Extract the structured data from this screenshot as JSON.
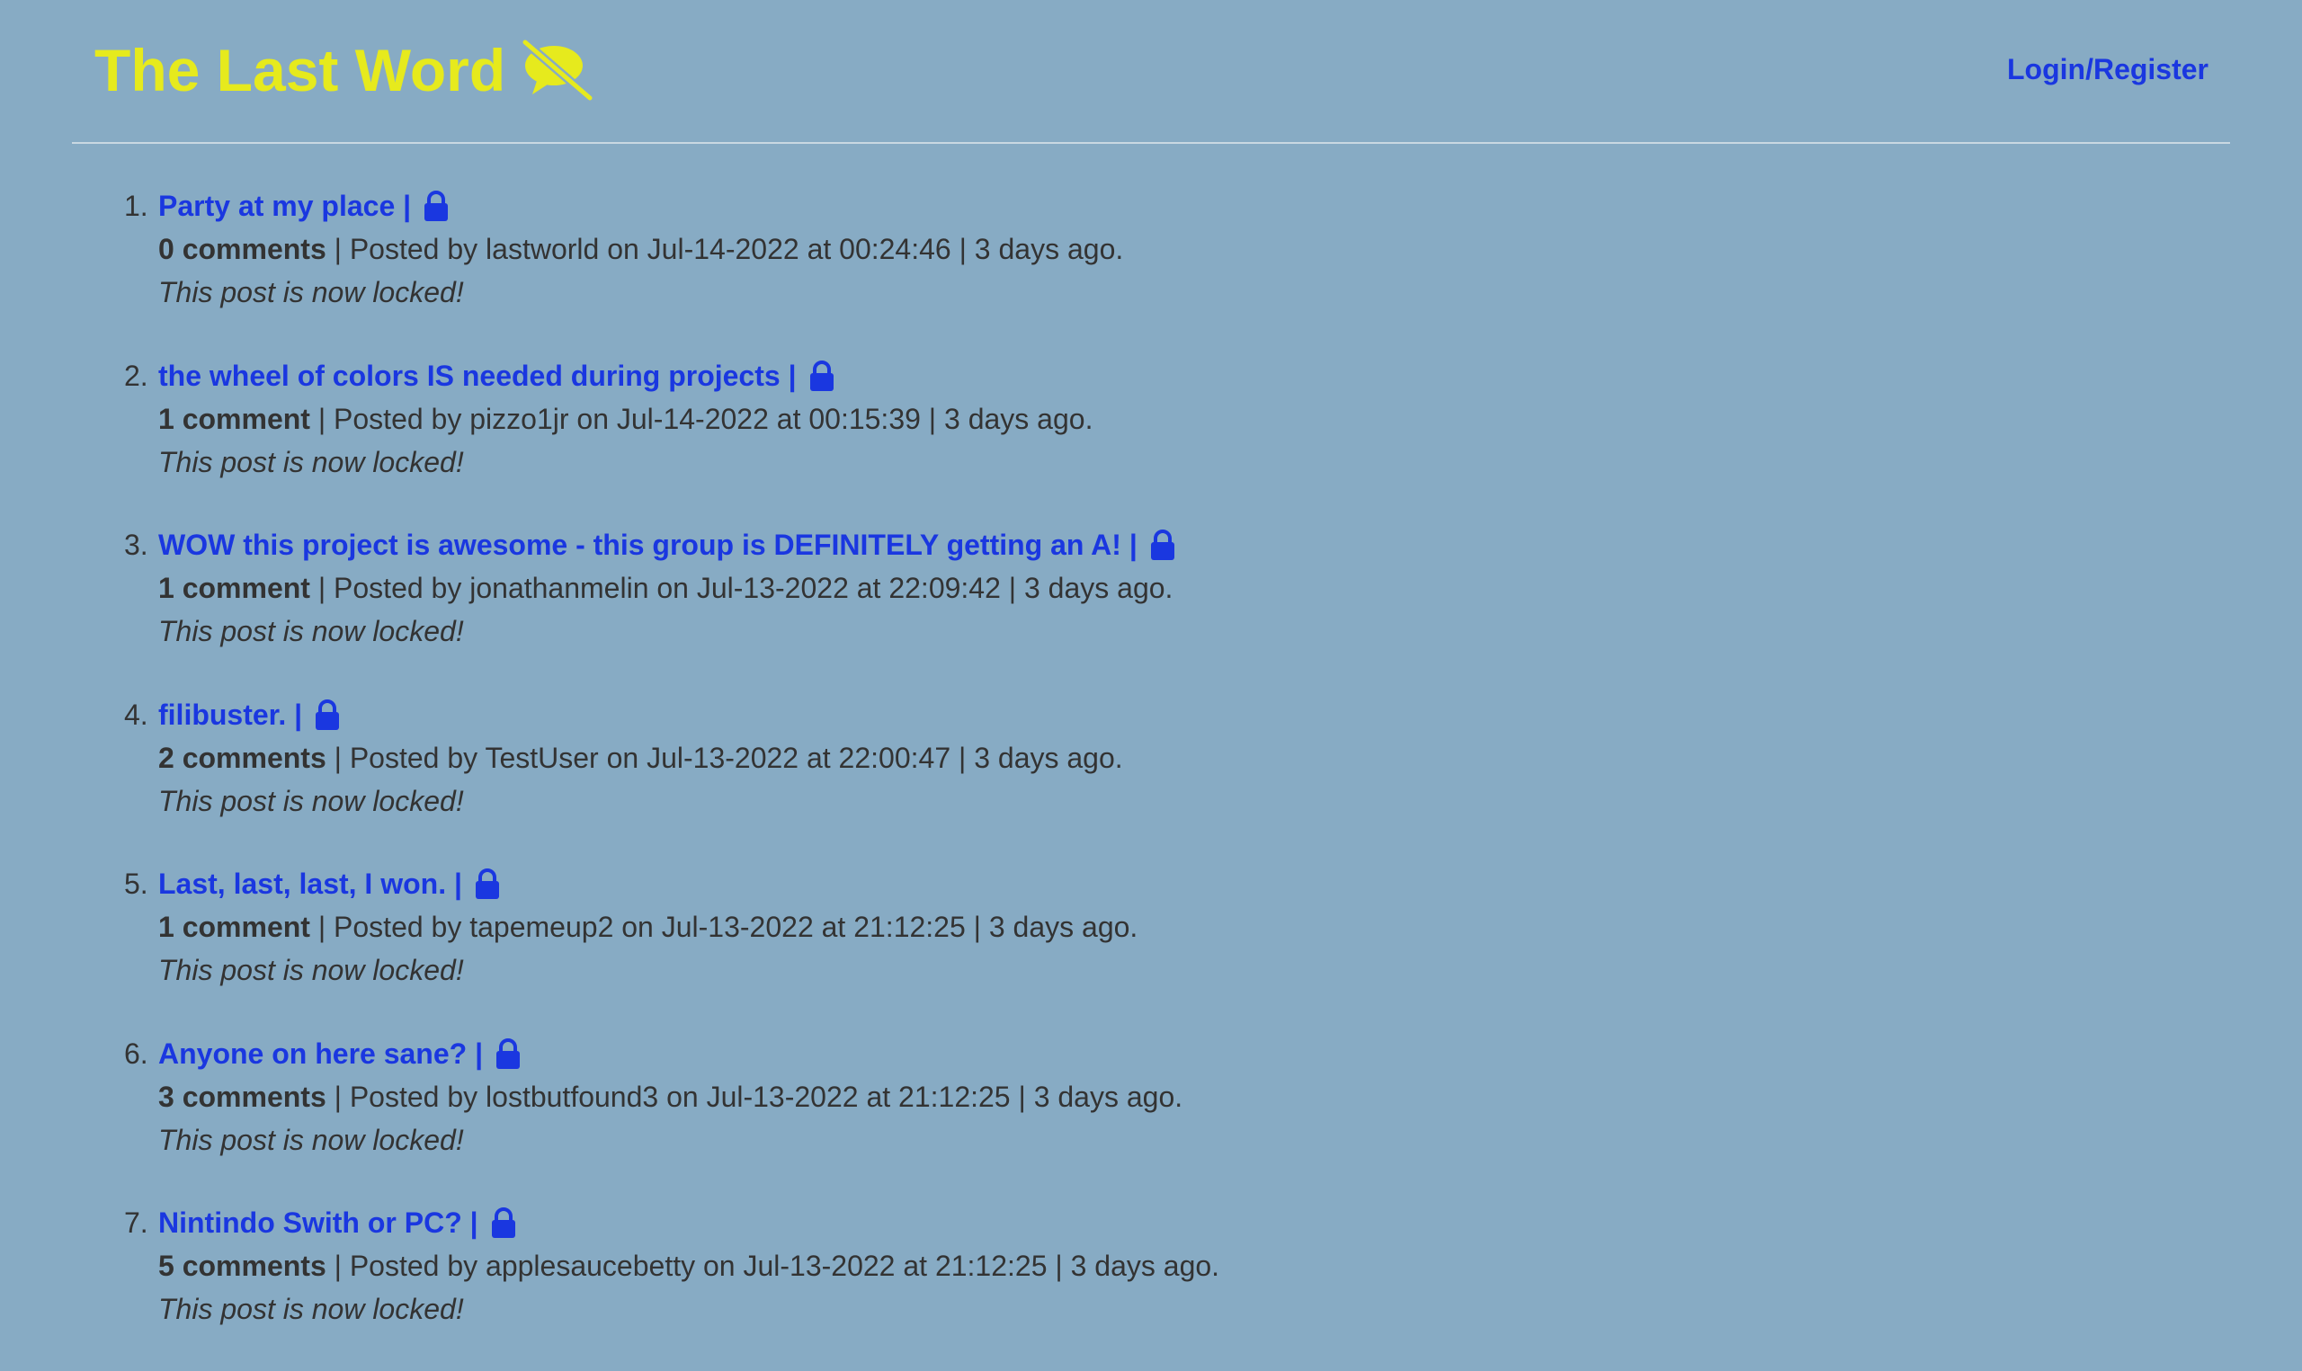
{
  "header": {
    "site_title": "The Last Word",
    "logo_icon": "speech-bubble-slash-icon",
    "login_label": "Login/Register",
    "title_color": "#e6ea1d",
    "link_color": "#1a37e0",
    "background_color": "#87abc4"
  },
  "posts": [
    {
      "num": "1.",
      "title": "Party at my place |",
      "comments": "0 comments",
      "meta": " | Posted by lastworld on Jul-14-2022 at 00:24:46 | 3 days ago.",
      "locked": "This post is now locked!"
    },
    {
      "num": "2.",
      "title": "the wheel of colors IS needed during projects |",
      "comments": "1 comment",
      "meta": " | Posted by pizzo1jr on Jul-14-2022 at 00:15:39 | 3 days ago.",
      "locked": "This post is now locked!"
    },
    {
      "num": "3.",
      "title": "WOW this project is awesome - this group is DEFINITELY getting an A! |",
      "comments": "1 comment",
      "meta": " | Posted by jonathanmelin on Jul-13-2022 at 22:09:42 | 3 days ago.",
      "locked": "This post is now locked!"
    },
    {
      "num": "4.",
      "title": "filibuster. |",
      "comments": "2 comments",
      "meta": " | Posted by TestUser on Jul-13-2022 at 22:00:47 | 3 days ago.",
      "locked": "This post is now locked!"
    },
    {
      "num": "5.",
      "title": "Last, last, last, I won. |",
      "comments": "1 comment",
      "meta": " | Posted by tapemeup2 on Jul-13-2022 at 21:12:25 | 3 days ago.",
      "locked": "This post is now locked!"
    },
    {
      "num": "6.",
      "title": "Anyone on here sane? |",
      "comments": "3 comments",
      "meta": " | Posted by lostbutfound3 on Jul-13-2022 at 21:12:25 | 3 days ago.",
      "locked": "This post is now locked!"
    },
    {
      "num": "7.",
      "title": "Nintindo Swith or PC? |",
      "comments": "5 comments",
      "meta": " | Posted by applesaucebetty on Jul-13-2022 at 21:12:25 | 3 days ago.",
      "locked": "This post is now locked!"
    }
  ],
  "lock_icon": "lock-icon"
}
